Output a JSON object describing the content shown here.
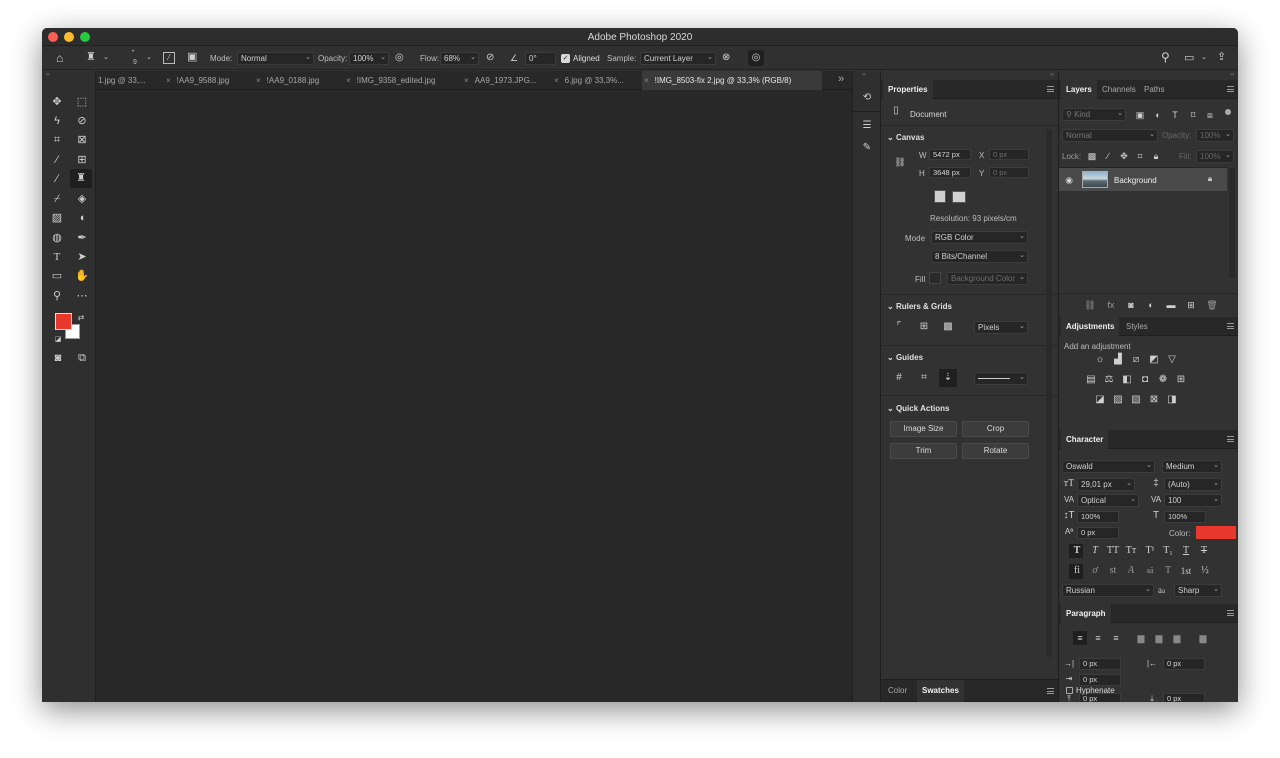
{
  "app_title": "Adobe Photoshop 2020",
  "colors": {
    "foreground": "#e8382c",
    "background": "#ffffff",
    "swatch_color": "#e8382c"
  },
  "options": {
    "brush_size": "9",
    "mode_label": "Mode:",
    "mode_value": "Normal",
    "opacity_label": "Opacity:",
    "opacity_value": "100%",
    "flow_label": "Flow:",
    "flow_value": "68%",
    "angle_value": "0°",
    "aligned_label": "Aligned",
    "aligned_checked": true,
    "sample_label": "Sample:",
    "sample_value": "Current Layer"
  },
  "tabs": [
    {
      "label": "1.jpg @ 33,..."
    },
    {
      "label": "!AA9_9588.jpg"
    },
    {
      "label": "!AA9_0188.jpg"
    },
    {
      "label": "!IMG_9358_edited.jpg"
    },
    {
      "label": "AA9_1973.JPG..."
    },
    {
      "label": "6.jpg @ 33,3%..."
    },
    {
      "label": "!IMG_8503-fix 2.jpg @ 33,3% (RGB/8)"
    }
  ],
  "properties": {
    "tab": "Properties",
    "doc_label": "Document",
    "canvas": {
      "title": "Canvas",
      "w_label": "W",
      "w_value": "5472 px",
      "x_label": "X",
      "x_value": "0 px",
      "h_label": "H",
      "h_value": "3648 px",
      "y_label": "Y",
      "y_value": "0 px",
      "resolution": "Resolution: 93 pixels/cm",
      "mode_label": "Mode",
      "mode_value": "RGB Color",
      "bits_value": "8 Bits/Channel",
      "fill_label": "Fill",
      "fill_value": "Background Color"
    },
    "rulers": {
      "title": "Rulers & Grids",
      "units": "Pixels"
    },
    "guides": {
      "title": "Guides"
    },
    "quick": {
      "title": "Quick Actions",
      "buttons": [
        "Image Size",
        "Crop",
        "Trim",
        "Rotate"
      ]
    },
    "bottom_tabs": [
      "Color",
      "Swatches"
    ]
  },
  "layers": {
    "tabs": [
      "Layers",
      "Channels",
      "Paths"
    ],
    "kind": "Kind",
    "blend": "Normal",
    "opacity_label": "Opacity:",
    "opacity_value": "100%",
    "lock_label": "Lock:",
    "fill_label": "Fill:",
    "fill_value": "100%",
    "layer_name": "Background"
  },
  "adjustments": {
    "tabs": [
      "Adjustments",
      "Styles"
    ],
    "add_label": "Add an adjustment"
  },
  "character": {
    "tab": "Character",
    "font": "Oswald",
    "style": "Medium",
    "size": "29,01 px",
    "leading": "(Auto)",
    "kerning": "Optical",
    "tracking": "100",
    "vscale": "100%",
    "hscale": "100%",
    "baseline": "0 px",
    "color_label": "Color:",
    "language": "Russian",
    "aa_label": "a",
    "antialias": "Sharp",
    "glyphs_row1": [
      "T",
      "T",
      "TT",
      "Tт",
      "T¹",
      "T₁",
      "T",
      "T"
    ],
    "glyphs_row2": [
      "fi",
      "ơ",
      "st",
      "A",
      "aā",
      "T",
      "1st",
      "½"
    ]
  },
  "paragraph": {
    "tab": "Paragraph",
    "indent_left": "0 px",
    "indent_right": "0 px",
    "indent_first": "0 px",
    "space_before": "0 px",
    "space_after": "0 px",
    "hyphenate": "Hyphenate"
  }
}
